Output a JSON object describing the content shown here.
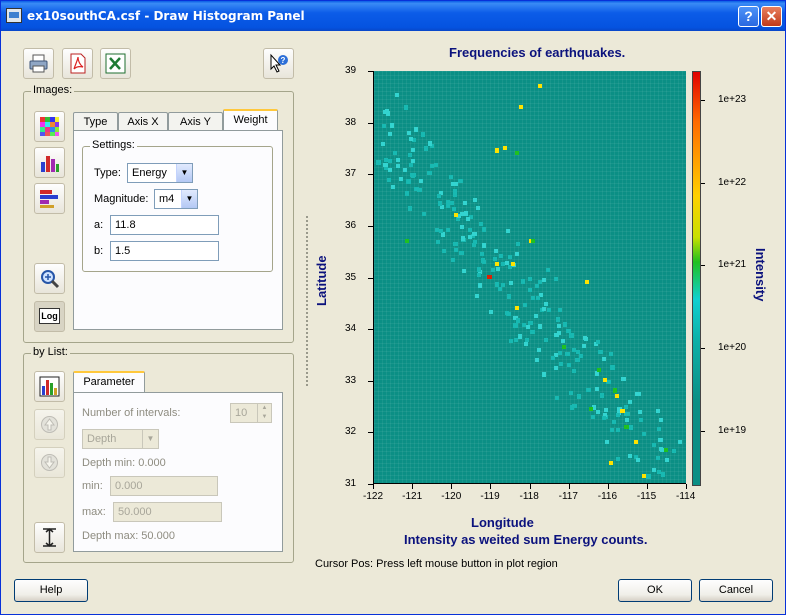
{
  "window": {
    "title": "ex10southCA.csf - Draw Histogram Panel"
  },
  "toolbar": {
    "print_icon": "printer-icon",
    "pdf_icon": "pdf-icon",
    "excel_icon": "excel-icon",
    "help_icon": "whats-this-help-icon"
  },
  "images_group": {
    "label": "Images:",
    "side_icons": [
      "color-grid-icon",
      "bar-chart-icon",
      "horizontal-bar-icon",
      "zoom-icon",
      "log-icon"
    ],
    "log_label": "Log",
    "tabs": [
      "Type",
      "Axis X",
      "Axis Y",
      "Weight"
    ],
    "active_tab": "Weight",
    "settings": {
      "label": "Settings:",
      "type_label": "Type:",
      "type_value": "Energy",
      "magnitude_label": "Magnitude:",
      "magnitude_value": "m4",
      "a_label": "a:",
      "a_value": "11.8",
      "b_label": "b:",
      "b_value": "1.5"
    }
  },
  "bylist_group": {
    "label": "by List:",
    "tab": "Parameter",
    "intervals_label": "Number of intervals:",
    "intervals_value": "10",
    "param_value": "Depth",
    "depth_min_text": "Depth min: 0.000",
    "min_label": "min:",
    "min_value": "0.000",
    "max_label": "max:",
    "max_value": "50.000",
    "depth_max_text": "Depth max: 50.000"
  },
  "buttons": {
    "help": "Help",
    "ok": "OK",
    "cancel": "Cancel"
  },
  "status": {
    "cursor_pos": "Cursor Pos: Press left mouse button in plot region"
  },
  "colors": {
    "background_bin": "#0b8f85",
    "title_text": "#0b127d"
  },
  "chart_data": {
    "type": "heatmap",
    "title": "Frequencies of earthquakes.",
    "xlabel": "Longitude",
    "ylabel": "Latitude",
    "colorbar_label": "Intensity",
    "subtitle": "Intensity as weited sum Energy counts.",
    "xlim": [
      -122,
      -114
    ],
    "ylim": [
      31,
      39
    ],
    "x_ticks": [
      "-122",
      "-121",
      "-120",
      "-119",
      "-118",
      "-117",
      "-116",
      "-115",
      "-114"
    ],
    "y_ticks": [
      "31",
      "32",
      "33",
      "34",
      "35",
      "36",
      "37",
      "38",
      "39"
    ],
    "color_scale": "log",
    "colorbar_ticks": [
      "1e+19",
      "1e+20",
      "1e+21",
      "1e+22",
      "1e+23"
    ],
    "hotspots": [
      {
        "lon": -119.1,
        "lat": 35.05,
        "level": "red"
      },
      {
        "lon": -118.9,
        "lat": 37.5,
        "level": "yellow"
      },
      {
        "lon": -118.7,
        "lat": 37.55,
        "level": "yellow"
      },
      {
        "lon": -118.9,
        "lat": 35.3,
        "level": "yellow"
      },
      {
        "lon": -118.5,
        "lat": 35.3,
        "level": "yellow"
      },
      {
        "lon": -118.4,
        "lat": 34.45,
        "level": "yellow"
      },
      {
        "lon": -117.8,
        "lat": 38.75,
        "level": "yellow"
      },
      {
        "lon": -118.3,
        "lat": 38.35,
        "level": "yellow"
      },
      {
        "lon": -119.95,
        "lat": 36.25,
        "level": "yellow"
      },
      {
        "lon": -116.6,
        "lat": 34.95,
        "level": "yellow"
      },
      {
        "lon": -116.15,
        "lat": 33.05,
        "level": "yellow"
      },
      {
        "lon": -115.85,
        "lat": 32.75,
        "level": "yellow"
      },
      {
        "lon": -115.7,
        "lat": 32.45,
        "level": "yellow"
      },
      {
        "lon": -115.35,
        "lat": 31.85,
        "level": "yellow"
      },
      {
        "lon": -115.15,
        "lat": 31.2,
        "level": "yellow"
      },
      {
        "lon": -116.0,
        "lat": 31.45,
        "level": "yellow"
      },
      {
        "lon": -118.05,
        "lat": 35.75,
        "level": "yellow"
      },
      {
        "lon": -118.4,
        "lat": 37.45,
        "level": "green"
      },
      {
        "lon": -118.0,
        "lat": 35.75,
        "level": "green"
      },
      {
        "lon": -121.2,
        "lat": 35.75,
        "level": "green"
      },
      {
        "lon": -116.3,
        "lat": 33.25,
        "level": "green"
      },
      {
        "lon": -115.9,
        "lat": 32.85,
        "level": "green"
      },
      {
        "lon": -115.6,
        "lat": 32.15,
        "level": "green"
      },
      {
        "lon": -114.6,
        "lat": 31.7,
        "level": "green"
      },
      {
        "lon": -116.5,
        "lat": 32.5,
        "level": "green"
      },
      {
        "lon": -117.2,
        "lat": 33.7,
        "level": "green"
      }
    ]
  }
}
